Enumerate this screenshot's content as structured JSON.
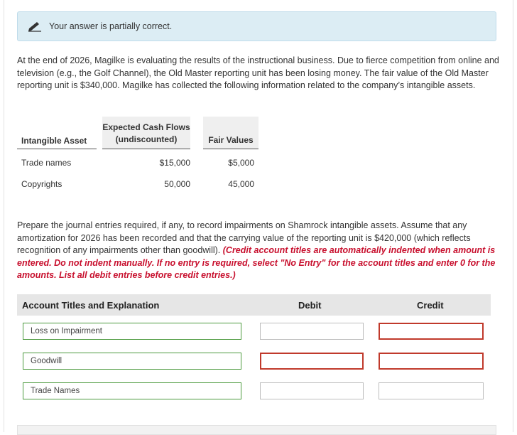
{
  "banner": {
    "icon": "pencil-icon",
    "message": "Your answer is partially correct."
  },
  "problem_text": "At the end of 2026, Magilke is evaluating the results of the instructional business. Due to fierce competition from online and television (e.g., the Golf Channel), the Old Master reporting unit has been losing money. The fair value of the Old Master reporting unit is $340,000. Magilke has collected the following information related to the company’s intangible assets.",
  "intangibles_table": {
    "headers": {
      "asset": "Intangible Asset",
      "cash_flows_line1": "Expected Cash Flows",
      "cash_flows_line2": "(undiscounted)",
      "fair_values": "Fair Values"
    },
    "rows": [
      {
        "asset": "Trade names",
        "cash_flows": "$15,000",
        "fair_value": "$5,000"
      },
      {
        "asset": "Copyrights",
        "cash_flows": "50,000",
        "fair_value": "45,000"
      }
    ]
  },
  "instructions": {
    "text": "Prepare the journal entries required, if any, to record impairments on Shamrock intangible assets. Assume that any amortization for 2026 has been recorded and that the carrying value of the reporting unit is $420,000 (which reflects recognition of any impairments other than goodwill).",
    "note": "(Credit account titles are automatically indented when amount is entered. Do not indent manually. If no entry is required, select \"No Entry\" for the account titles and enter 0 for the amounts. List all debit entries before credit entries.)"
  },
  "journal": {
    "headers": {
      "account": "Account Titles and Explanation",
      "debit": "Debit",
      "credit": "Credit"
    },
    "rows": [
      {
        "account": "Loss on Impairment",
        "debit": "",
        "credit": ""
      },
      {
        "account": "Goodwill",
        "debit": "",
        "credit": ""
      },
      {
        "account": "Trade Names",
        "debit": "",
        "credit": ""
      }
    ]
  },
  "colors": {
    "banner_bg": "#dcedf4",
    "error_border": "#c0392b",
    "correct_border": "#4c9a3e",
    "instruction_red": "#c8102e"
  }
}
